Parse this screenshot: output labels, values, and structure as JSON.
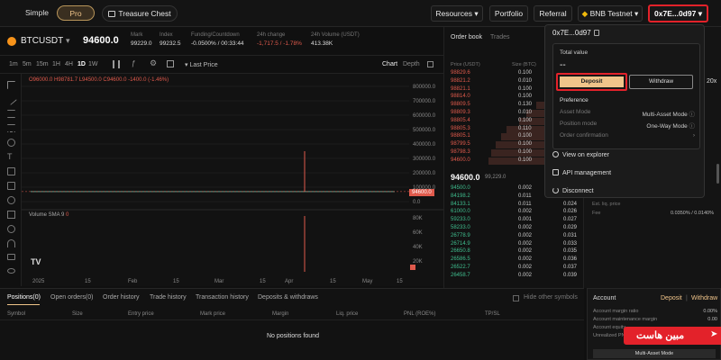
{
  "nav": {
    "simple": "Simple",
    "pro": "Pro",
    "treasure": "Treasure Chest",
    "resources": "Resources",
    "portfolio": "Portfolio",
    "referral": "Referral",
    "network": "BNB Testnet",
    "wallet": "0x7E...0d97"
  },
  "ticker": {
    "symbol": "BTCUSDT",
    "price": "94600.0",
    "mark_label": "Mark",
    "mark": "99229.0",
    "index_label": "Index",
    "index": "99232.5",
    "funding_label": "Funding/Countdown",
    "funding": "-0.0500% / 00:33:44",
    "change_label": "24h change",
    "change": "-1,717.5 / -1.78%",
    "volume_label": "24h Volume (USDT)",
    "volume": "413.38K"
  },
  "chartbar": {
    "timeframes": [
      "1m",
      "5m",
      "15m",
      "1H",
      "4H",
      "1D",
      "1W"
    ],
    "active": "1D",
    "last_price": "Last Price",
    "chart": "Chart",
    "depth": "Depth"
  },
  "chart": {
    "ohlc": "O96000.0 H98781.7 L94500.0 C94600.0 -1400.0 (-1.46%)",
    "volume_label": "Volume SMA 9",
    "volume_value": "0",
    "price_tag": "94600.0",
    "y_prices": [
      "800000.0",
      "700000.0",
      "600000.0",
      "500000.0",
      "400000.0",
      "300000.0",
      "200000.0",
      "100000.0",
      "0.0"
    ],
    "y_volume": [
      "80K",
      "60K",
      "40K",
      "20K"
    ],
    "x_labels": [
      "2025",
      "15",
      "Feb",
      "15",
      "Mar",
      "15",
      "Apr",
      "15",
      "May",
      "15"
    ],
    "logo": "TV"
  },
  "chart_data": {
    "type": "line",
    "title": "",
    "x": [
      "2025",
      "15",
      "Feb",
      "15",
      "Mar",
      "15",
      "Apr",
      "15",
      "May",
      "15"
    ],
    "series": [
      {
        "values": [
          94600,
          94600,
          94600,
          94600,
          94600,
          94600,
          94600,
          94600,
          94600,
          94600
        ]
      }
    ],
    "ylim": [
      0,
      800000
    ],
    "grid": true
  },
  "orderbook": {
    "tab_book": "Order book",
    "tab_trades": "Trades",
    "col_price": "Price (USDT)",
    "col_size": "Size (BTC)",
    "col_total": "",
    "asks": [
      [
        "98829.6",
        "0.100",
        ""
      ],
      [
        "98821.2",
        "0.010",
        ""
      ],
      [
        "98821.1",
        "0.100",
        ""
      ],
      [
        "98814.0",
        "0.100",
        ""
      ],
      [
        "98809.5",
        "0.130",
        ""
      ],
      [
        "98809.3",
        "0.010",
        ""
      ],
      [
        "98805.4",
        "0.100",
        ""
      ],
      [
        "98805.3",
        "0.110",
        ""
      ],
      [
        "98805.1",
        "0.100",
        ""
      ],
      [
        "98799.5",
        "0.100",
        ""
      ],
      [
        "98798.3",
        "0.100",
        ""
      ],
      [
        "94600.0",
        "0.100",
        ""
      ]
    ],
    "mid_price": "94600.0",
    "mid_sub": "99,229.0",
    "bids": [
      [
        "94500.0",
        "0.002",
        "0.002"
      ],
      [
        "84198.2",
        "0.011",
        "0.013"
      ],
      [
        "84133.1",
        "0.011",
        "0.024"
      ],
      [
        "61000.0",
        "0.002",
        "0.026"
      ],
      [
        "59233.0",
        "0.001",
        "0.027"
      ],
      [
        "58233.0",
        "0.002",
        "0.029"
      ],
      [
        "26778.9",
        "0.002",
        "0.031"
      ],
      [
        "26714.9",
        "0.002",
        "0.033"
      ],
      [
        "26650.8",
        "0.002",
        "0.035"
      ],
      [
        "26586.5",
        "0.002",
        "0.036"
      ],
      [
        "26522.7",
        "0.002",
        "0.037"
      ],
      [
        "26458.7",
        "0.002",
        "0.039"
      ]
    ]
  },
  "dropdown": {
    "address": "0x7E...0d97",
    "total_label": "Total value",
    "total_value": "--",
    "deposit": "Deposit",
    "withdraw": "Withdraw",
    "preference": "Preference",
    "asset_mode_label": "Asset Mode",
    "asset_mode": "Multi-Asset Mode",
    "position_mode_label": "Position mode",
    "position_mode": "One-Way Mode",
    "order_conf_label": "Order confirmation",
    "explorer": "View on explorer",
    "api": "API management",
    "disconnect": "Disconnect"
  },
  "rightpanel": {
    "leverage": "20x",
    "est_liq_label": "Est. liq. price",
    "fee_label": "Fee",
    "fee_value": "0.0350% / 0.0140%"
  },
  "bottom": {
    "tabs": [
      "Positions(0)",
      "Open orders(0)",
      "Order history",
      "Trade history",
      "Transaction history",
      "Deposits & withdraws"
    ],
    "hide_other": "Hide other symbols",
    "columns": [
      "Symbol",
      "Size",
      "Entry price",
      "Mark price",
      "Margin",
      "Liq. price",
      "PNL (ROE%)",
      "TP/SL"
    ],
    "empty": "No positions found"
  },
  "account": {
    "title": "Account",
    "deposit": "Deposit",
    "withdraw": "Withdraw",
    "rows": [
      [
        "Account margin ratio",
        "0.00%"
      ],
      [
        "Account maintenance margin",
        "0.00"
      ],
      [
        "Account equity",
        "--"
      ],
      [
        "Unrealized PNL",
        ""
      ]
    ],
    "mode_button": "Multi-Asset Mode"
  },
  "watermark": "مبین هاست",
  "colors": {
    "accent": "#f0c48a",
    "highlight": "#e3222a",
    "ask": "#e05a4c",
    "bid": "#3fbf8f"
  }
}
